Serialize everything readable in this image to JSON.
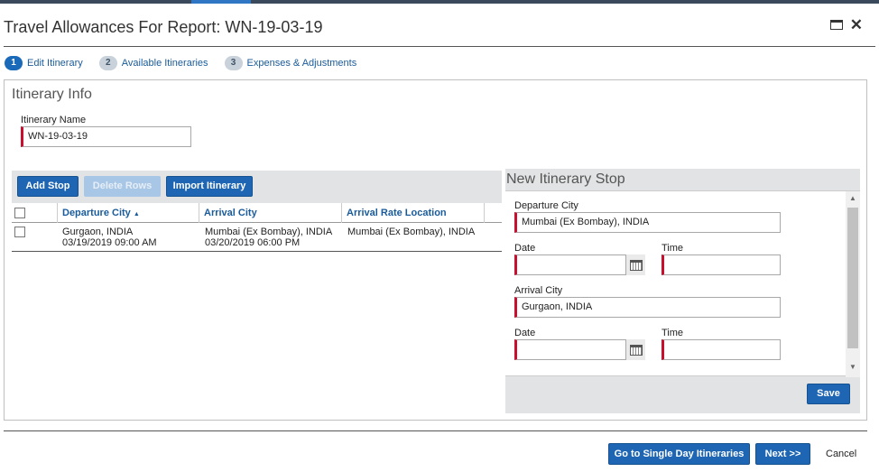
{
  "dialog": {
    "title": "Travel Allowances For Report: WN-19-03-19",
    "maximize_icon": "maximize-icon",
    "close_icon": "close-icon"
  },
  "steps": [
    {
      "number": "1",
      "label": "Edit Itinerary",
      "active": true
    },
    {
      "number": "2",
      "label": "Available Itineraries",
      "active": false
    },
    {
      "number": "3",
      "label": "Expenses & Adjustments",
      "active": false
    }
  ],
  "itinerary_info": {
    "heading": "Itinerary Info",
    "name_label": "Itinerary Name",
    "name_value": "WN-19-03-19"
  },
  "toolbar": {
    "add_stop": "Add Stop",
    "delete_rows": "Delete Rows",
    "import_itinerary": "Import Itinerary"
  },
  "grid": {
    "columns": [
      "Departure City",
      "Arrival City",
      "Arrival Rate Location"
    ],
    "sort_indicator": "▲",
    "rows": [
      {
        "departure_city": "Gurgaon, INDIA",
        "departure_time": "03/19/2019 09:00 AM",
        "arrival_city": "Mumbai (Ex Bombay), INDIA",
        "arrival_time": "03/20/2019 06:00 PM",
        "arrival_rate_location": "Mumbai (Ex Bombay), INDIA"
      }
    ]
  },
  "new_stop": {
    "heading": "New Itinerary Stop",
    "departure_city_label": "Departure City",
    "departure_city_value": "Mumbai (Ex Bombay), INDIA",
    "date_label": "Date",
    "time_label": "Time",
    "departure_date_value": "",
    "departure_time_value": "",
    "arrival_city_label": "Arrival City",
    "arrival_city_value": "Gurgaon, INDIA",
    "arrival_date_value": "",
    "arrival_time_value": "",
    "save": "Save",
    "calendar_icon": "calendar-icon"
  },
  "footer": {
    "single_day": "Go to Single Day Itineraries",
    "next": "Next >>",
    "cancel": "Cancel"
  },
  "colors": {
    "primary": "#1e66b3",
    "required_marker": "#c8102e",
    "panel_bg": "#e1e3e4"
  }
}
